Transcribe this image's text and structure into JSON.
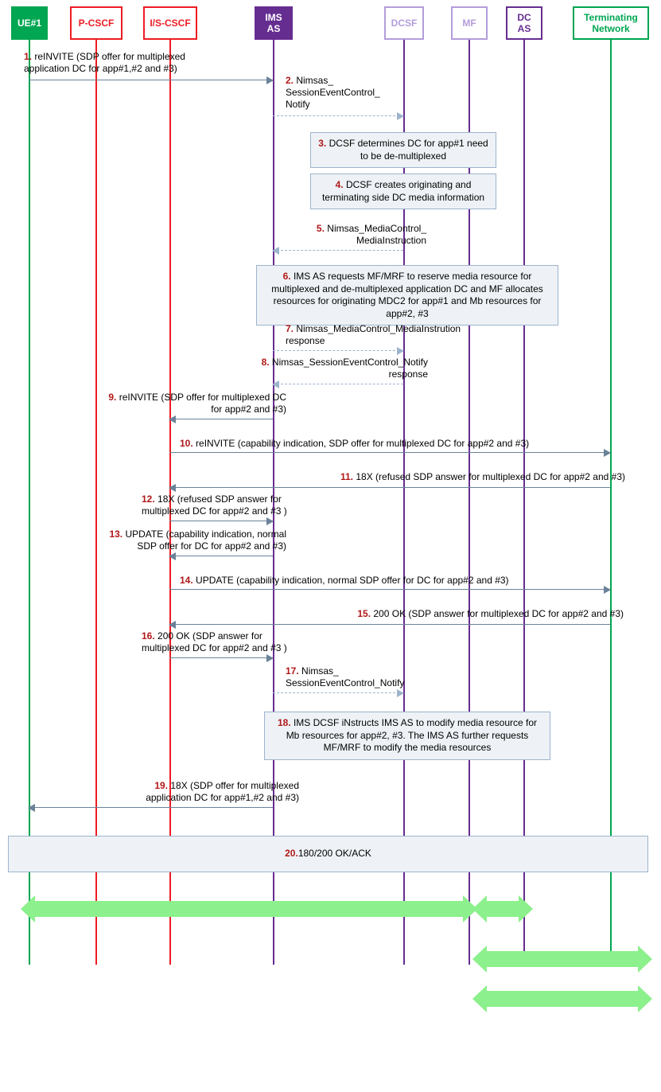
{
  "participants": {
    "ue1": "UE#1",
    "pcscf": "P-CSCF",
    "iscscf": "I/S-CSCF",
    "imsas": "IMS AS",
    "dcsf": "DCSF",
    "mf": "MF",
    "dcas": "DC AS",
    "term": "Terminating Network"
  },
  "steps": {
    "s1": {
      "n": "1.",
      "t": " reINVITE (SDP offer for multiplexed application DC for app#1,#2 and #3)"
    },
    "s2": {
      "n": "2.",
      "t": " Nimsas_ SessionEventControl_ Notify"
    },
    "s3": {
      "n": "3.",
      "t": " DCSF determines DC for app#1 need to be de-multiplexed"
    },
    "s4": {
      "n": "4.",
      "t": " DCSF creates originating and terminating side DC media information"
    },
    "s5": {
      "n": "5.",
      "t": " Nimsas_MediaControl_ MediaInstruction"
    },
    "s6": {
      "n": "6.",
      "t": " IMS AS requests MF/MRF to reserve media resource for multiplexed and de-multiplexed application DC and MF allocates resources for originating MDC2 for app#1 and Mb resources for app#2, #3"
    },
    "s7": {
      "n": "7.",
      "t": " Nimsas_MediaControl_MediaInstrution response"
    },
    "s8": {
      "n": "8.",
      "t": " Nimsas_SessionEventControl_Notify response"
    },
    "s9": {
      "n": "9.",
      "t": " reINVITE (SDP offer for multiplexed DC for app#2 and #3)"
    },
    "s10": {
      "n": "10.",
      "t": " reINVITE (capability indication, SDP offer for multiplexed DC for app#2 and #3)"
    },
    "s11": {
      "n": "11.",
      "t": " 18X (refused SDP answer for multiplexed DC for app#2 and #3)"
    },
    "s12": {
      "n": "12.",
      "t": " 18X (refused SDP answer for multiplexed DC for app#2 and #3 )"
    },
    "s13": {
      "n": "13.",
      "t": " UPDATE (capability indication, normal SDP offer for DC for app#2 and #3)"
    },
    "s14": {
      "n": "14.",
      "t": " UPDATE (capability indication, normal SDP offer for DC for app#2 and #3)"
    },
    "s15": {
      "n": "15.",
      "t": " 200 OK (SDP answer for multiplexed DC for app#2 and #3)"
    },
    "s16": {
      "n": "16.",
      "t": " 200 OK (SDP answer for multiplexed DC for app#2 and #3 )"
    },
    "s17": {
      "n": "17.",
      "t": " Nimsas_ SessionEventControl_Notify"
    },
    "s18": {
      "n": "18.",
      "t": " IMS DCSF iNstructs IMS AS to modify media resource for Mb resources for app#2, #3. The IMS AS further requests MF/MRF to modify the media resources"
    },
    "s19": {
      "n": "19.",
      "t": " 18X (SDP offer for multiplexed application DC for app#1,#2 and #3)"
    },
    "s20": {
      "n": "20.",
      "t": " 180/200 OK/ACK"
    }
  }
}
